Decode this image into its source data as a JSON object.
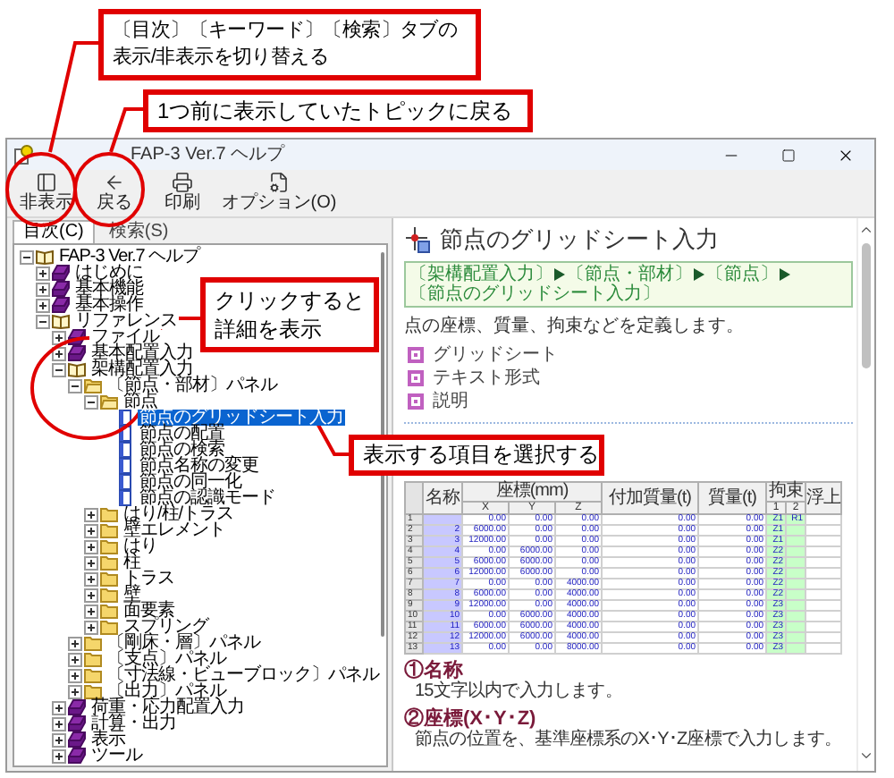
{
  "callouts": [
    {
      "lines": [
        "〔目次〕〔キーワード〕〔検索〕タブの",
        "表示/非表示を切り替える"
      ]
    },
    {
      "lines": [
        "1つ前に表示していたトピックに戻る"
      ]
    },
    {
      "lines": [
        "クリックすると",
        "詳細を表示"
      ]
    },
    {
      "lines": [
        "表示する項目を選択する"
      ]
    }
  ],
  "window": {
    "title": "FAP-3 Ver.7 ヘルプ"
  },
  "toolbar": [
    {
      "label": "非表示"
    },
    {
      "label": "戻る"
    },
    {
      "label": "印刷"
    },
    {
      "label": "オプション(O)"
    }
  ],
  "tabs": [
    {
      "label": "目次(C)",
      "selected": true
    },
    {
      "label": "検索(S)",
      "selected": false
    }
  ],
  "tree": [
    {
      "kind": "book",
      "label": "FAP-3 Ver.7 ヘルプ",
      "expanded": true,
      "selected": false,
      "children": [
        {
          "kind": "book",
          "label": "はじめに",
          "expanded": false,
          "selected": false
        },
        {
          "kind": "book",
          "label": "基本機能",
          "expanded": false,
          "selected": false
        },
        {
          "kind": "book",
          "label": "基本操作",
          "expanded": false,
          "selected": false
        },
        {
          "kind": "book",
          "label": "リファレンス",
          "expanded": true,
          "selected": false,
          "children": [
            {
              "kind": "book",
              "label": "ファイル",
              "expanded": false,
              "selected": false
            },
            {
              "kind": "book",
              "label": "基本配置入力",
              "expanded": false,
              "selected": false
            },
            {
              "kind": "book",
              "label": "架構配置入力",
              "expanded": true,
              "selected": false,
              "children": [
                {
                  "kind": "folder",
                  "label": "〔節点・部材〕パネル",
                  "expanded": true,
                  "selected": false,
                  "children": [
                    {
                      "kind": "folder",
                      "label": "節点",
                      "expanded": true,
                      "selected": false,
                      "children": [
                        {
                          "kind": "page",
                          "label": "節点のグリッドシート入力",
                          "selected": true
                        },
                        {
                          "kind": "page",
                          "label": "節点の配置",
                          "selected": false
                        },
                        {
                          "kind": "page",
                          "label": "節点の検索",
                          "selected": false
                        },
                        {
                          "kind": "page",
                          "label": "節点名称の変更",
                          "selected": false
                        },
                        {
                          "kind": "page",
                          "label": "節点の同一化",
                          "selected": false
                        },
                        {
                          "kind": "page",
                          "label": "節点の認識モード",
                          "selected": false
                        }
                      ]
                    },
                    {
                      "kind": "folder",
                      "label": "はり/柱/トラス",
                      "expanded": false,
                      "selected": false
                    },
                    {
                      "kind": "folder",
                      "label": "壁エレメント",
                      "expanded": false,
                      "selected": false
                    },
                    {
                      "kind": "folder",
                      "label": "はり",
                      "expanded": false,
                      "selected": false
                    },
                    {
                      "kind": "folder",
                      "label": "柱",
                      "expanded": false,
                      "selected": false
                    },
                    {
                      "kind": "folder",
                      "label": "トラス",
                      "expanded": false,
                      "selected": false
                    },
                    {
                      "kind": "folder",
                      "label": "壁",
                      "expanded": false,
                      "selected": false
                    },
                    {
                      "kind": "folder",
                      "label": "面要素",
                      "expanded": false,
                      "selected": false
                    },
                    {
                      "kind": "folder",
                      "label": "スプリング",
                      "expanded": false,
                      "selected": false
                    }
                  ]
                },
                {
                  "kind": "folder",
                  "label": "〔剛床・層〕パネル",
                  "expanded": false,
                  "selected": false
                },
                {
                  "kind": "folder",
                  "label": "〔支点〕パネル",
                  "expanded": false,
                  "selected": false
                },
                {
                  "kind": "folder",
                  "label": "〔寸法線・ビューブロック〕パネル",
                  "expanded": false,
                  "selected": false
                },
                {
                  "kind": "folder",
                  "label": "〔出力〕パネル",
                  "expanded": false,
                  "selected": false
                }
              ]
            },
            {
              "kind": "book",
              "label": "荷重・応力配置入力",
              "expanded": false,
              "selected": false
            },
            {
              "kind": "book",
              "label": "計算・出力",
              "expanded": false,
              "selected": false
            },
            {
              "kind": "book",
              "label": "表示",
              "expanded": false,
              "selected": false
            },
            {
              "kind": "book",
              "label": "ツール",
              "expanded": false,
              "selected": false
            }
          ]
        }
      ]
    }
  ],
  "topic": {
    "title": "節点のグリッドシート入力",
    "breadcrumb": [
      "〔架構配置入力〕",
      "〔節点・部材〕",
      "〔節点〕",
      "〔節点のグリッドシート入力〕"
    ],
    "intro": "点の座標、質量、拘束などを定義します。",
    "links": [
      "グリッドシート",
      "テキスト形式",
      "説明"
    ],
    "grid": {
      "column_groups": [
        {
          "kind": "name",
          "label": "名称"
        },
        {
          "kind": "coord",
          "label": "座標(mm)",
          "sub": [
            "X",
            "Y",
            "Z"
          ]
        },
        {
          "kind": "added_mass",
          "label": "付加質量(t)"
        },
        {
          "kind": "mass",
          "label": "質量(t)"
        },
        {
          "kind": "constraint",
          "label": "拘束",
          "sub": [
            "1",
            "2"
          ]
        },
        {
          "kind": "float",
          "label": "浮上"
        }
      ],
      "rows": [
        {
          "number": "1",
          "cells": [
            null,
            "0.00",
            "0.00",
            "0.00",
            "0.00",
            "0.00",
            "Z1",
            "R1"
          ]
        },
        {
          "number": "2",
          "cells": [
            "2",
            "6000.00",
            "0.00",
            "0.00",
            "0.00",
            "0.00",
            "Z1"
          ]
        },
        {
          "number": "3",
          "cells": [
            "3",
            "12000.00",
            "0.00",
            "0.00",
            "0.00",
            "0.00",
            "Z1"
          ]
        },
        {
          "number": "4",
          "cells": [
            "4",
            "0.00",
            "6000.00",
            "0.00",
            "0.00",
            "0.00",
            "Z2"
          ]
        },
        {
          "number": "5",
          "cells": [
            "5",
            "6000.00",
            "6000.00",
            "0.00",
            "0.00",
            "0.00",
            "Z2"
          ]
        },
        {
          "number": "6",
          "cells": [
            "6",
            "12000.00",
            "6000.00",
            "0.00",
            "0.00",
            "0.00",
            "Z2"
          ]
        },
        {
          "number": "7",
          "cells": [
            "7",
            "0.00",
            "0.00",
            "4000.00",
            "0.00",
            "0.00",
            "Z2"
          ]
        },
        {
          "number": "8",
          "cells": [
            "8",
            "6000.00",
            "0.00",
            "4000.00",
            "0.00",
            "0.00",
            "Z2"
          ]
        },
        {
          "number": "9",
          "cells": [
            "9",
            "12000.00",
            "0.00",
            "4000.00",
            "0.00",
            "0.00",
            "Z3"
          ]
        },
        {
          "number": "10",
          "cells": [
            "10",
            "0.00",
            "6000.00",
            "4000.00",
            "0.00",
            "0.00",
            "Z3"
          ]
        },
        {
          "number": "11",
          "cells": [
            "11",
            "6000.00",
            "6000.00",
            "4000.00",
            "0.00",
            "0.00",
            "Z3"
          ]
        },
        {
          "number": "12",
          "cells": [
            "12",
            "12000.00",
            "6000.00",
            "4000.00",
            "0.00",
            "0.00",
            "Z3"
          ]
        },
        {
          "number": "13",
          "cells": [
            "13",
            "0.00",
            "0.00",
            "8000.00",
            "0.00",
            "0.00",
            "Z3"
          ]
        }
      ]
    },
    "sections": [
      {
        "heading": "①名称",
        "text": "15文字以内で入力します。"
      },
      {
        "heading": "②座標(X･Y･Z)",
        "text": "節点の位置を、基準座標系のX･Y･Z座標で入力します。"
      }
    ]
  }
}
